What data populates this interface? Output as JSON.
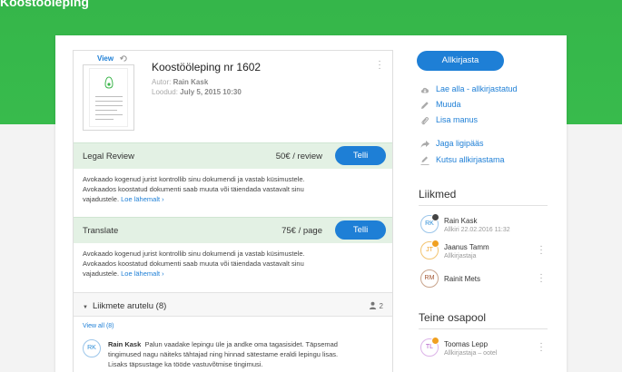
{
  "header": {
    "title": "Koostööleping"
  },
  "document": {
    "view_label": "View",
    "title": "Koostööleping nr 1602",
    "author_label": "Autor:",
    "author": "Rain Kask",
    "created_label": "Loodud:",
    "created": "July 5, 2015 10:30"
  },
  "services": [
    {
      "name": "Legal Review",
      "price": "50€ / review",
      "button": "Telli",
      "desc_line1": "Avokaado kogenud jurist kontrollib sinu dokumendi ja vastab küsimustele.",
      "desc_line2": "Avokaados koostatud dokumenti saab muuta või täiendada vastavalt sinu",
      "desc_line3": "vajadustele.",
      "link": "Loe lähemalt ›"
    },
    {
      "name": "Translate",
      "price": "75€ / page",
      "button": "Telli",
      "desc_line1": "Avokaado kogenud jurist kontrollib sinu dokumendi ja vastab küsimustele.",
      "desc_line2": "Avokaados koostatud dokumenti saab muuta või täiendada vastavalt sinu",
      "desc_line3": "vajadustele.",
      "link": "Loe lähemalt ›"
    }
  ],
  "discussion": {
    "title": "Liikmete arutelu (8)",
    "participants": "2",
    "view_all": "View all (8)",
    "comment": {
      "initials": "RK",
      "author": "Rain Kask",
      "line1": "Palun vaadake lepingu üle ja andke oma tagasisidet. Täpsemad",
      "line2": "tingimused nagu näiteks tähtajad ning hinnad sätestame eraldi lepingu lisas.",
      "line3": "Lisaks täpsustage ka tööde vastuvõtmise tingimusi."
    }
  },
  "sidebar": {
    "sign_button": "Allkirjasta",
    "actions": [
      {
        "icon": "cloud-download-icon",
        "label": "Lae alla - allkirjastatud"
      },
      {
        "icon": "pencil-icon",
        "label": "Muuda"
      },
      {
        "icon": "paperclip-icon",
        "label": "Lisa manus"
      },
      {
        "icon": "share-icon",
        "label": "Jaga ligipääs"
      },
      {
        "icon": "signature-pen-icon",
        "label": "Kutsu allkirjastama"
      }
    ],
    "members_title": "Liikmed",
    "members": [
      {
        "initials": "RK",
        "name": "Rain Kask",
        "status": "Allkiri 22.02.2016 11:32",
        "color": "#2f8fd8",
        "badge": "#444444"
      },
      {
        "initials": "JT",
        "name": "Jaanus Tamm",
        "status": "Allkirjastaja",
        "color": "#f0a020",
        "badge": "#f0a020"
      },
      {
        "initials": "RM",
        "name": "Rainit Mets",
        "status": "",
        "color": "#a0522d",
        "badge": ""
      }
    ],
    "other_party_title": "Teine osapool",
    "other_party": [
      {
        "initials": "TL",
        "name": "Toomas Lepp",
        "status": "Allkirjastaja – ootel",
        "color": "#b05cc8",
        "badge": "#f0a020"
      }
    ]
  },
  "colors": {
    "brand_green": "#38bb4c",
    "accent_blue": "#1e7fd6",
    "service_bg": "#e3f1e4"
  }
}
